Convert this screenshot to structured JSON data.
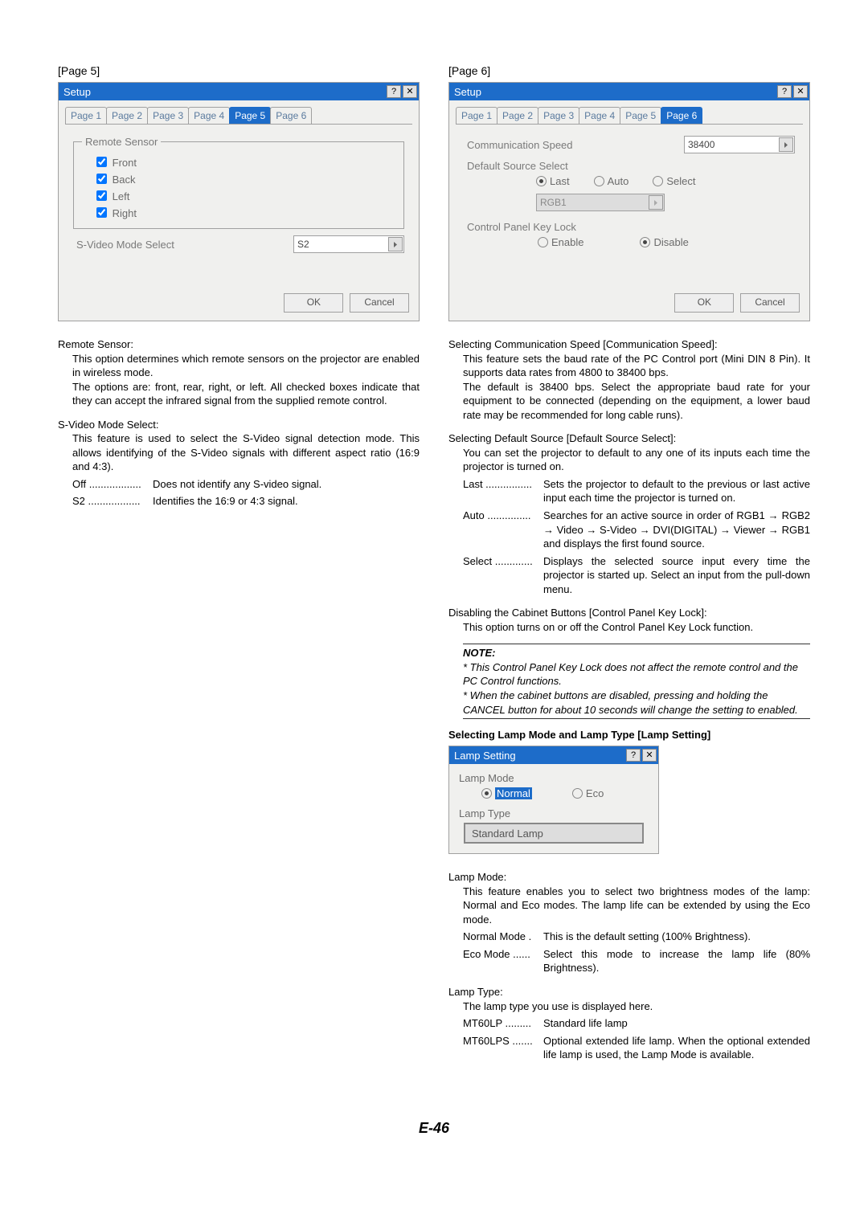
{
  "page_number": "E-46",
  "left": {
    "caption": "[Page 5]",
    "dialog_title": "Setup",
    "tabs": [
      "Page 1",
      "Page 2",
      "Page 3",
      "Page 4",
      "Page 5",
      "Page 6"
    ],
    "active_tab": 4,
    "fieldset_legend": "Remote Sensor",
    "checks": [
      "Front",
      "Back",
      "Left",
      "Right"
    ],
    "svideo_label": "S-Video Mode Select",
    "svideo_value": "S2",
    "ok": "OK",
    "cancel": "Cancel",
    "sections": {
      "remote_title": "Remote Sensor:",
      "remote_body1": "This option determines which remote sensors on the projector are enabled in wireless mode.",
      "remote_body2": "The options are: front, rear, right, or left. All checked boxes indicate that they can accept the infrared signal from the supplied remote control.",
      "svideo_title": "S-Video Mode Select:",
      "svideo_body1": "This feature is used to select the S-Video signal detection mode. This allows identifying of the S-Video signals with different aspect ratio (16:9 and 4:3).",
      "off_label": "Off ..................",
      "off_text": "Does not identify any S-video signal.",
      "s2_label": "S2 ..................",
      "s2_text": "Identifies the 16:9 or 4:3 signal."
    }
  },
  "right": {
    "caption": "[Page 6]",
    "dialog_title": "Setup",
    "tabs": [
      "Page 1",
      "Page 2",
      "Page 3",
      "Page 4",
      "Page 5",
      "Page 6"
    ],
    "active_tab": 5,
    "comm_label": "Communication Speed",
    "comm_value": "38400",
    "default_src_label": "Default Source Select",
    "radios": [
      "Last",
      "Auto",
      "Select"
    ],
    "src_value": "RGB1",
    "lock_label": "Control Panel Key Lock",
    "lock_radios": [
      "Enable",
      "Disable"
    ],
    "ok": "OK",
    "cancel": "Cancel",
    "sections": {
      "comm_title": "Selecting Communication Speed [Communication Speed]:",
      "comm_body": "This feature sets the baud rate of the PC Control port (Mini DIN 8 Pin). It supports data rates from 4800 to 38400 bps.\nThe default is 38400 bps. Select the appropriate baud rate for your equipment to be connected (depending on the equipment, a lower baud rate may be recommended for long cable runs).",
      "src_title": "Selecting Default Source [Default Source Select]:",
      "src_body": "You can set the projector to default to any one of its inputs each time the projector is turned on.",
      "last_label": "Last ................",
      "last_text": "Sets the projector to default to the previous or last active input each time the projector is turned on.",
      "auto_label": "Auto ...............",
      "auto_text": "Searches for an active source in order of RGB1 → RGB2 → Video → S-Video → DVI(DIGITAL) → Viewer → RGB1 and displays the first found source.",
      "select_label": "Select .............",
      "select_text": "Displays the selected source input every time the projector is started up. Select an input from the pull-down menu.",
      "lock_title": "Disabling the Cabinet Buttons [Control Panel Key Lock]:",
      "lock_body": "This option turns on or off the Control Panel Key Lock function.",
      "note_title": "NOTE:",
      "note1": "* This Control Panel Key Lock does not affect the remote control and the PC Control functions.",
      "note2": "* When the cabinet buttons are disabled, pressing and holding the CANCEL button for about 10 seconds will change the setting to enabled.",
      "lamp_heading": "Selecting Lamp Mode and Lamp Type [Lamp Setting]",
      "lamp_dialog_title": "Lamp Setting",
      "lamp_mode_label": "Lamp Mode",
      "lamp_normal": "Normal",
      "lamp_eco": "Eco",
      "lamp_type_label": "Lamp Type",
      "lamp_type_value": "Standard Lamp",
      "mode_title": "Lamp Mode:",
      "mode_body": "This feature enables you to select two brightness modes of the lamp: Normal and Eco modes. The lamp life can be extended by using the Eco mode.",
      "normal_label": "Normal Mode .",
      "normal_text": "This is the default setting (100% Brightness).",
      "eco_label": "Eco Mode ......",
      "eco_text": "Select this mode to increase the lamp life (80% Brightness).",
      "type_title": "Lamp Type:",
      "type_body": "The lamp type you use is displayed here.",
      "mt60lp_label": "MT60LP .........",
      "mt60lp_text": "Standard life lamp",
      "mt60lps_label": "MT60LPS .......",
      "mt60lps_text": "Optional extended life lamp. When the optional extended life lamp is used, the Lamp Mode is available."
    }
  }
}
